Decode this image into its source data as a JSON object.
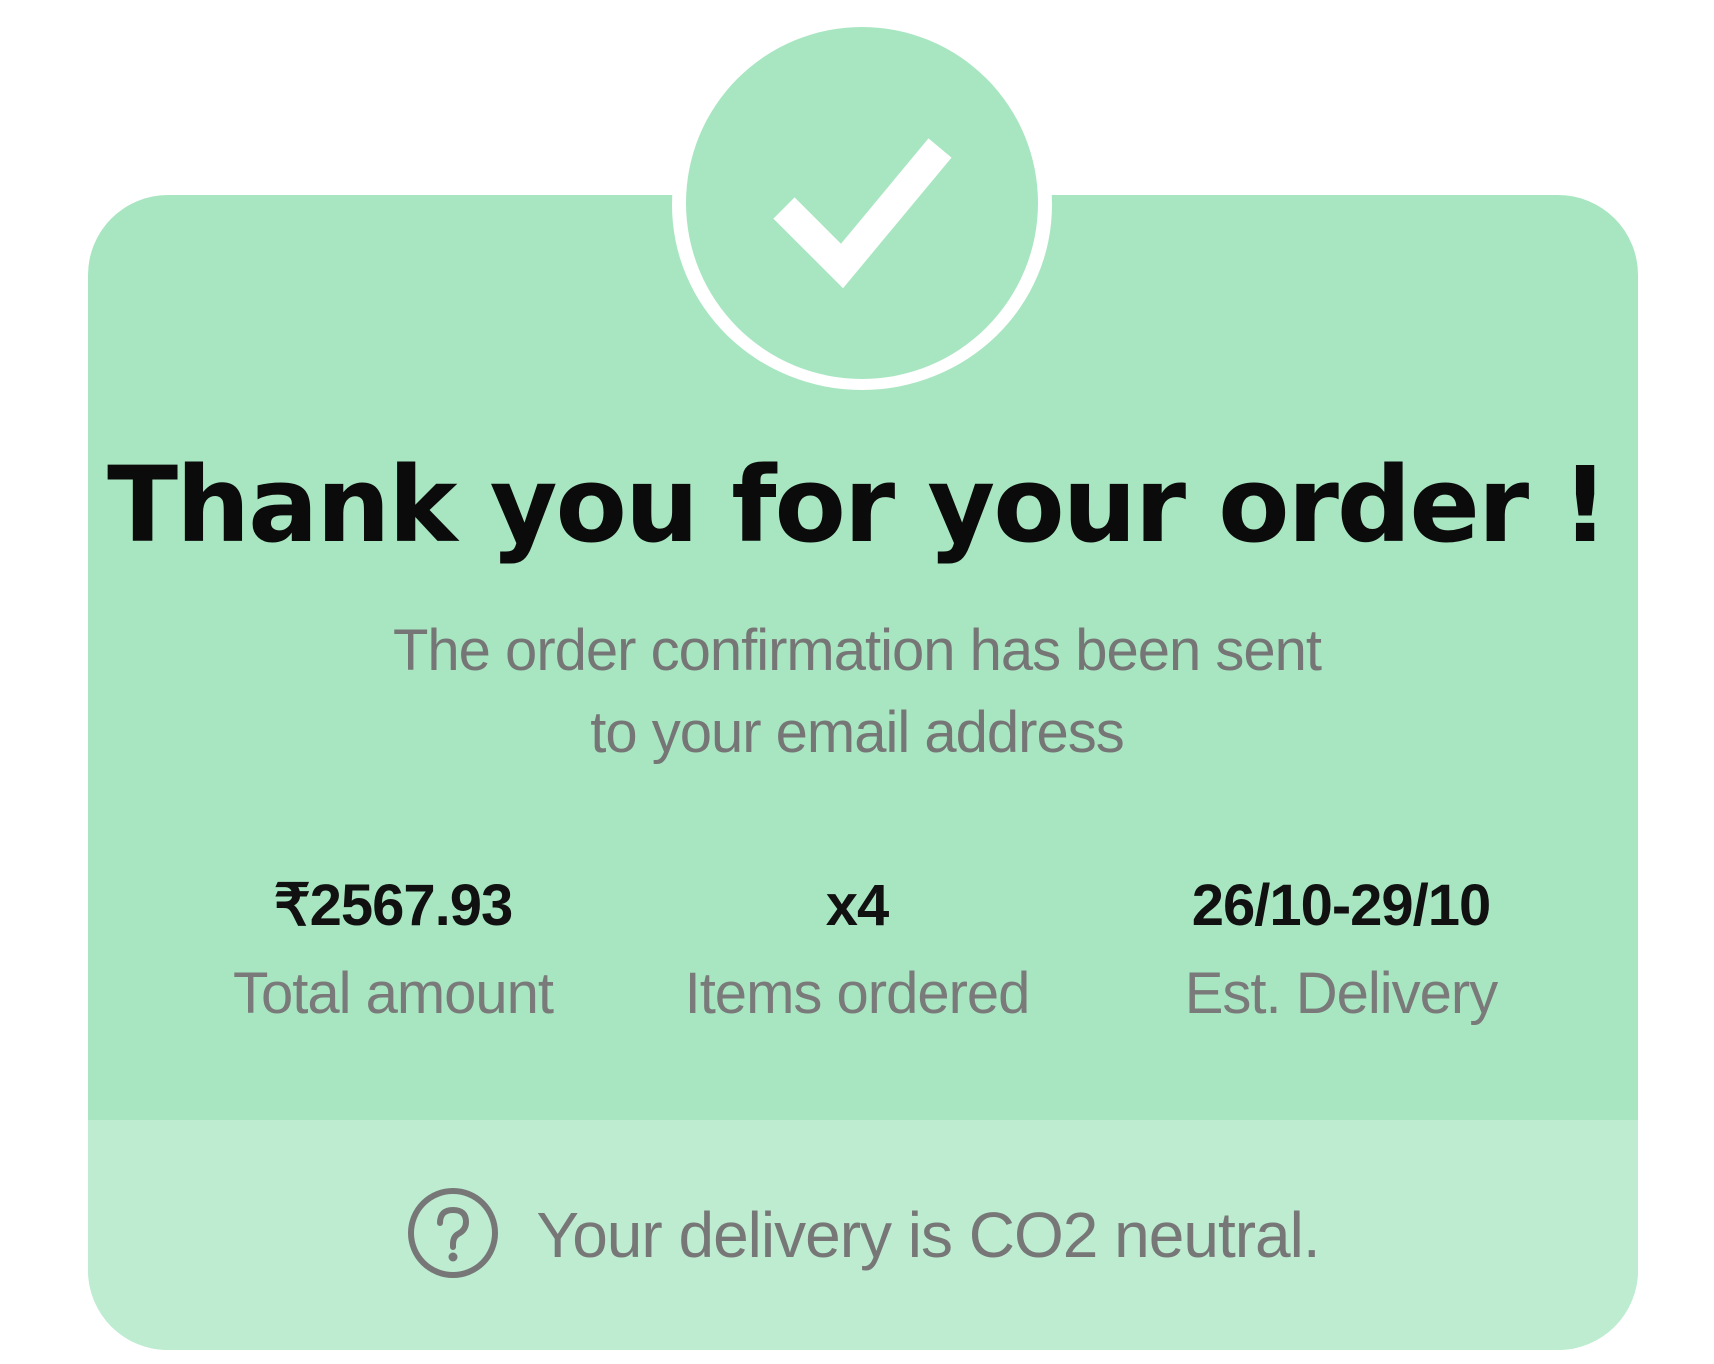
{
  "confirmation": {
    "title": "Thank you for your order !",
    "subtitle_line1": "The order confirmation has been sent",
    "subtitle_line2": "to your email address"
  },
  "stats": [
    {
      "value": "₹2567.93",
      "label": "Total amount"
    },
    {
      "value": "x4",
      "label": "Items ordered"
    },
    {
      "value": "26/10-29/10",
      "label": "Est. Delivery"
    }
  ],
  "footer": {
    "note": "Your delivery is CO2 neutral."
  },
  "icons": {
    "badge": "checkmark-icon",
    "footer": "question-circle-icon"
  },
  "colors": {
    "card": "#a8e6c1",
    "footer": "#bdecd1",
    "title": "#0b0b0b",
    "muted": "#767676"
  }
}
